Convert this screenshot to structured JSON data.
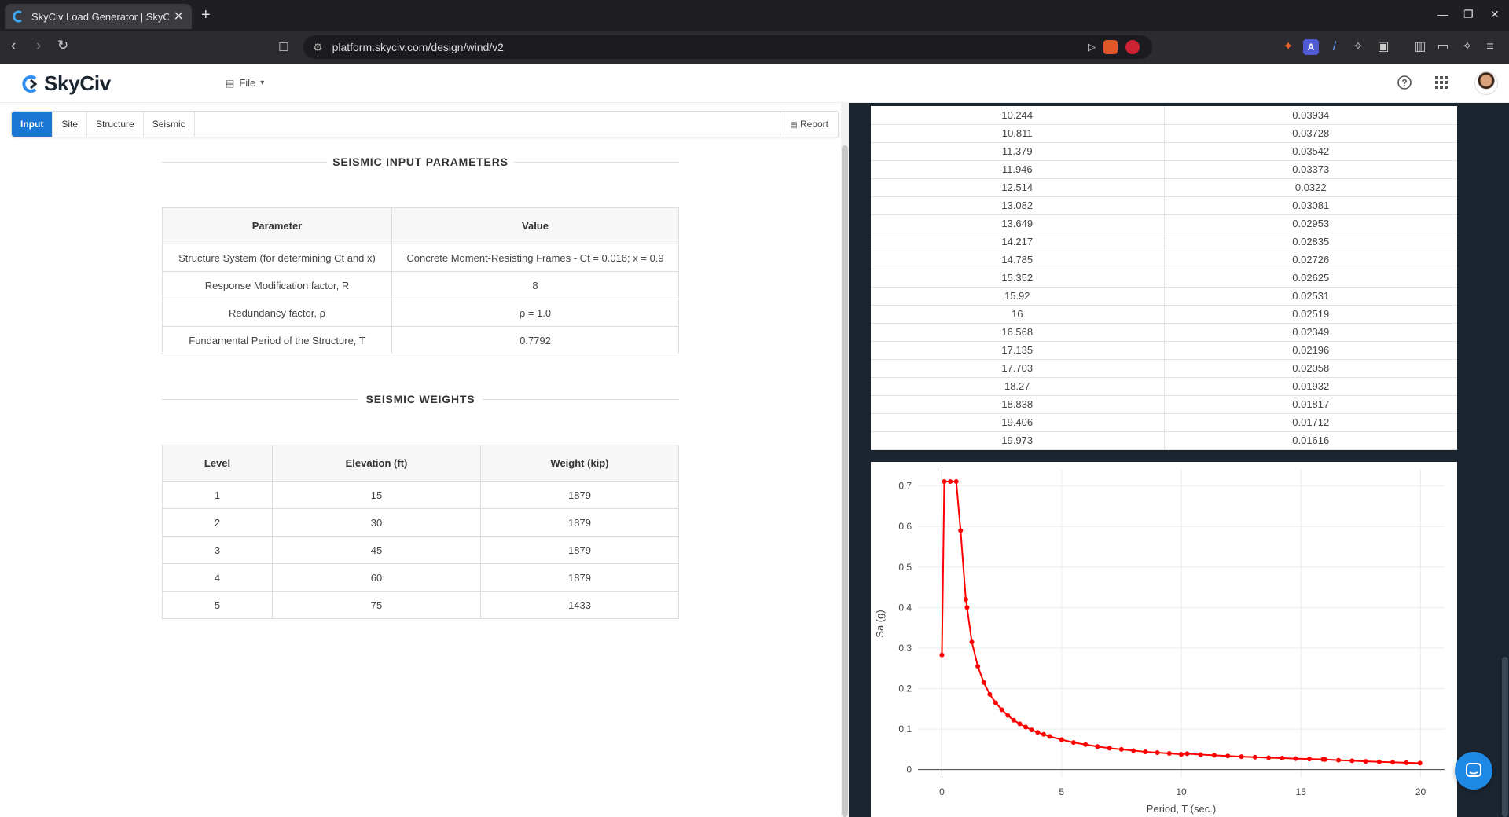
{
  "browser": {
    "tab_title": "SkyCiv Load Generator | SkyCiv",
    "tab_close": "✕",
    "new_tab": "+",
    "url": "platform.skyciv.com/design/wind/v2"
  },
  "app": {
    "logo_text": "SkyCiv",
    "file_menu": "File"
  },
  "subtabs": {
    "items": [
      {
        "label": "Input"
      },
      {
        "label": "Site"
      },
      {
        "label": "Structure"
      },
      {
        "label": "Seismic"
      }
    ],
    "report": "Report"
  },
  "seismic_input": {
    "title": "SEISMIC INPUT PARAMETERS",
    "headers": [
      "Parameter",
      "Value"
    ],
    "rows": [
      [
        "Structure System (for determining Ct and x)",
        "Concrete Moment-Resisting Frames - Ct = 0.016; x = 0.9"
      ],
      [
        "Response Modification factor, R",
        "8"
      ],
      [
        "Redundancy factor, ρ",
        "ρ = 1.0"
      ],
      [
        "Fundamental Period of the Structure, T",
        "0.7792"
      ]
    ]
  },
  "seismic_weights": {
    "title": "SEISMIC WEIGHTS",
    "headers": [
      "Level",
      "Elevation (ft)",
      "Weight (kip)"
    ],
    "rows": [
      [
        "1",
        "15",
        "1879"
      ],
      [
        "2",
        "30",
        "1879"
      ],
      [
        "3",
        "45",
        "1879"
      ],
      [
        "4",
        "60",
        "1879"
      ],
      [
        "5",
        "75",
        "1433"
      ]
    ]
  },
  "spectrum_table": {
    "rows": [
      [
        "10.244",
        "0.03934"
      ],
      [
        "10.811",
        "0.03728"
      ],
      [
        "11.379",
        "0.03542"
      ],
      [
        "11.946",
        "0.03373"
      ],
      [
        "12.514",
        "0.0322"
      ],
      [
        "13.082",
        "0.03081"
      ],
      [
        "13.649",
        "0.02953"
      ],
      [
        "14.217",
        "0.02835"
      ],
      [
        "14.785",
        "0.02726"
      ],
      [
        "15.352",
        "0.02625"
      ],
      [
        "15.92",
        "0.02531"
      ],
      [
        "16",
        "0.02519"
      ],
      [
        "16.568",
        "0.02349"
      ],
      [
        "17.135",
        "0.02196"
      ],
      [
        "17.703",
        "0.02058"
      ],
      [
        "18.27",
        "0.01932"
      ],
      [
        "18.838",
        "0.01817"
      ],
      [
        "19.406",
        "0.01712"
      ],
      [
        "19.973",
        "0.01616"
      ]
    ]
  },
  "chart_data": {
    "type": "line",
    "xlabel": "Period, T (sec.)",
    "ylabel": "Sa (g)",
    "xlim": [
      -1,
      21
    ],
    "ylim": [
      -0.02,
      0.74
    ],
    "xticks": [
      0,
      5,
      10,
      15,
      20
    ],
    "yticks": [
      0,
      0.1,
      0.2,
      0.3,
      0.4,
      0.5,
      0.6,
      0.7
    ],
    "ytick_labels": [
      "0",
      "0.1",
      "0.2",
      "0.3",
      "0.4",
      "0.5",
      "0.6",
      "0.7"
    ],
    "grid": true,
    "color": "#ff0000",
    "series": [
      {
        "x": [
          0,
          0.1,
          0.35,
          0.6,
          0.78,
          1.0,
          1.05,
          1.25,
          1.5,
          1.75,
          2.0,
          2.25,
          2.5,
          2.75,
          3.0,
          3.25,
          3.5,
          3.75,
          4.0,
          4.25,
          4.5,
          5.0,
          5.5,
          6.0,
          6.5,
          7.0,
          7.5,
          8.0,
          8.5,
          9.0,
          9.5,
          10.0,
          10.244,
          10.811,
          11.379,
          11.946,
          12.514,
          13.082,
          13.649,
          14.217,
          14.785,
          15.352,
          15.92,
          16.0,
          16.568,
          17.135,
          17.703,
          18.27,
          18.838,
          19.406,
          19.973
        ],
        "y": [
          0.283,
          0.711,
          0.711,
          0.711,
          0.59,
          0.42,
          0.4,
          0.315,
          0.255,
          0.215,
          0.186,
          0.165,
          0.148,
          0.134,
          0.122,
          0.113,
          0.105,
          0.098,
          0.092,
          0.087,
          0.082,
          0.074,
          0.067,
          0.062,
          0.057,
          0.053,
          0.05,
          0.047,
          0.044,
          0.042,
          0.04,
          0.038,
          0.03934,
          0.03728,
          0.03542,
          0.03373,
          0.0322,
          0.03081,
          0.02953,
          0.02835,
          0.02726,
          0.02625,
          0.02531,
          0.02519,
          0.02349,
          0.02196,
          0.02058,
          0.01932,
          0.01817,
          0.01712,
          0.01616
        ]
      }
    ]
  }
}
